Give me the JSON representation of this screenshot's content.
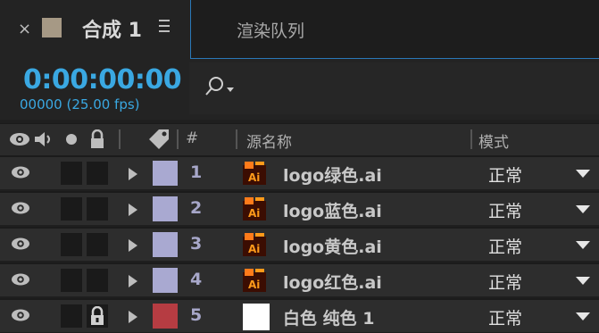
{
  "tabs": {
    "close": "×",
    "composition": "合成 1",
    "render_queue": "渲染队列",
    "swatch_color": "#a69985"
  },
  "time": {
    "timecode": "0:00:00:00",
    "frames_fps": "00000 (25.00 fps)"
  },
  "columns": {
    "number": "#",
    "source_name": "源名称",
    "mode": "模式"
  },
  "layers": [
    {
      "number": "1",
      "name": "logo绿色.ai",
      "mode": "正常",
      "type": "ai",
      "label_color": "#a9a9d1",
      "locked": false
    },
    {
      "number": "2",
      "name": "logo蓝色.ai",
      "mode": "正常",
      "type": "ai",
      "label_color": "#a9a9d1",
      "locked": false
    },
    {
      "number": "3",
      "name": "logo黄色.ai",
      "mode": "正常",
      "type": "ai",
      "label_color": "#a9a9d1",
      "locked": false
    },
    {
      "number": "4",
      "name": "logo红色.ai",
      "mode": "正常",
      "type": "ai",
      "label_color": "#a9a9d1",
      "locked": false
    },
    {
      "number": "5",
      "name": "白色 纯色 1",
      "mode": "正常",
      "type": "solid",
      "label_color": "#b63c42",
      "locked": true
    }
  ],
  "ai_icon_text": "Ai"
}
